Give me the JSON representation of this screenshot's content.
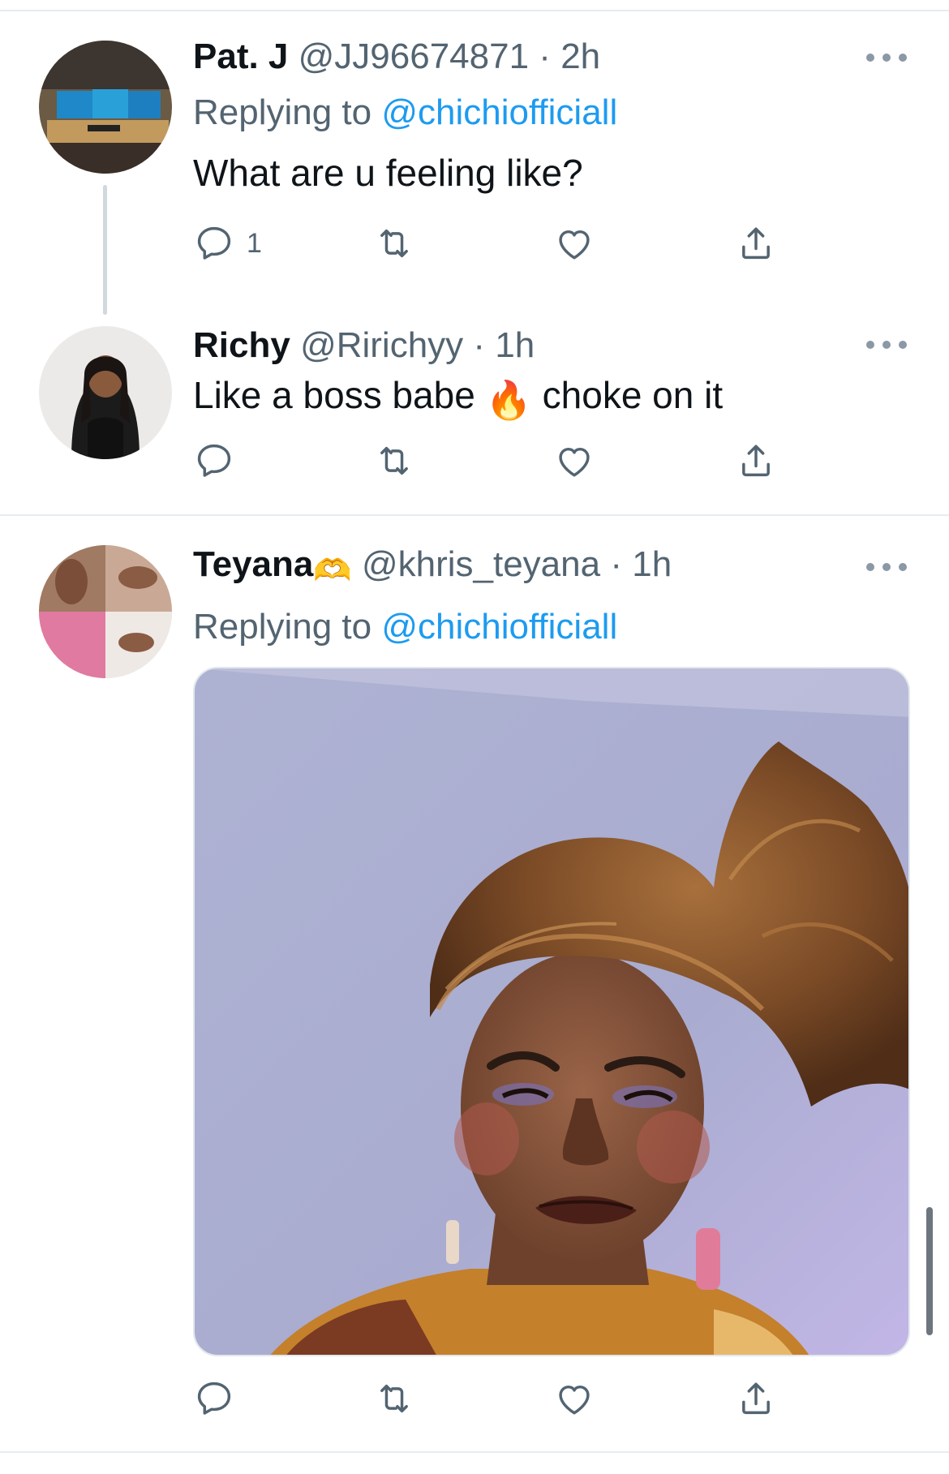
{
  "tweets": [
    {
      "name": "Pat. J",
      "handle": "@JJ96674871",
      "separator": "·",
      "time": "2h",
      "replying_prefix": "Replying to ",
      "replying_to": "@chichiofficiall",
      "text": "What are u feeling like?",
      "reply_count": "1",
      "avatar_icon": "desk-setup-photo"
    },
    {
      "name": "Richy",
      "handle": "@Ririchyy",
      "separator": "·",
      "time": "1h",
      "text_before": "Like a boss babe ",
      "emoji": "🔥",
      "text_after": " choke on it",
      "avatar_icon": "woman-portrait-photo"
    },
    {
      "name": "Teyana",
      "name_emoji": "🫶",
      "handle": "@khris_teyana",
      "separator": "·",
      "time": "1h",
      "replying_prefix": "Replying to ",
      "replying_to": "@chichiofficiall",
      "media_icon": "woman-with-headwrap-photo",
      "avatar_icon": "hands-collage-photo"
    }
  ],
  "icons": {
    "reply": "comment-icon",
    "retweet": "retweet-icon",
    "like": "heart-icon",
    "share": "share-icon",
    "more": "more-options-icon"
  },
  "colors": {
    "link": "#1d9bf0",
    "secondary_text": "#536471",
    "primary_text": "#0f1419",
    "divider": "#e6ecf0"
  }
}
